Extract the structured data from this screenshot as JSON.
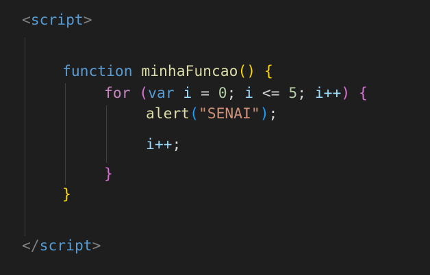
{
  "code": {
    "open_tag": {
      "lt": "<",
      "name": "script",
      "gt": ">"
    },
    "function_line": {
      "keyword": "function",
      "name": "minhaFuncao",
      "parens": "()",
      "brace": "{"
    },
    "for_line": {
      "keyword": "for",
      "open_paren": "(",
      "var_kw": "var",
      "var_name": "i",
      "assign": "=",
      "init": "0",
      "sep1": ";",
      "cond_var": "i",
      "cond_op": "<=",
      "cond_val": "5",
      "sep2": ";",
      "inc": "i++",
      "close_paren": ")",
      "brace": "{"
    },
    "alert_line": {
      "fn": "alert",
      "open_paren": "(",
      "arg": "\"SENAI\"",
      "close_paren": ")",
      "semi": ";"
    },
    "inc_line": {
      "expr": "i++",
      "semi": ";"
    },
    "close_for": "}",
    "close_function": "}",
    "close_tag": {
      "lt": "</",
      "name": "script",
      "gt": ">"
    }
  },
  "colors": {
    "background": "#1e1e1e",
    "keyword": "#569cd6",
    "control": "#c586c0",
    "function": "#dcdcaa",
    "variable": "#9cdcfe",
    "number": "#b5cea8",
    "string": "#ce9178",
    "bracket_level1": "#ffd700",
    "bracket_level2": "#da70d6",
    "bracket_level3": "#179fff"
  }
}
